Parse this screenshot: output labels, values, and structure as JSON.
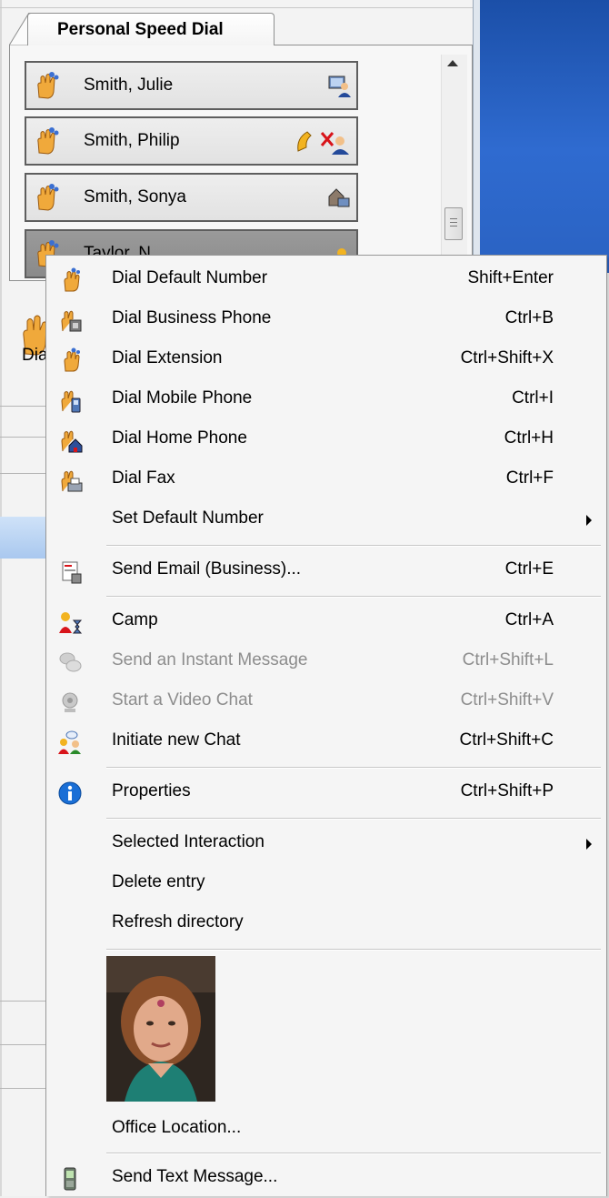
{
  "tab": {
    "label": "Personal Speed Dial"
  },
  "speed_dial": [
    {
      "name": "Smith, Julie",
      "status_icon": "computer-user-icon"
    },
    {
      "name": "Smith, Philip",
      "status_icon": "phone-no-user-icon"
    },
    {
      "name": "Smith, Sonya",
      "status_icon": "home-computer-icon"
    },
    {
      "name": "Taylor, N",
      "status_icon": "user-icon"
    }
  ],
  "background": {
    "dial_label": "Dia"
  },
  "menu": {
    "items": [
      {
        "label": "Dial Default Number",
        "shortcut": "Shift+Enter",
        "icon": "dial-hand-icon"
      },
      {
        "label": "Dial Business Phone",
        "shortcut": "Ctrl+B",
        "icon": "dial-business-icon"
      },
      {
        "label": "Dial Extension",
        "shortcut": "Ctrl+Shift+X",
        "icon": "dial-hand-icon"
      },
      {
        "label": "Dial Mobile Phone",
        "shortcut": "Ctrl+I",
        "icon": "dial-mobile-icon"
      },
      {
        "label": "Dial Home Phone",
        "shortcut": "Ctrl+H",
        "icon": "dial-home-icon"
      },
      {
        "label": "Dial Fax",
        "shortcut": "Ctrl+F",
        "icon": "dial-fax-icon"
      },
      {
        "label": "Set Default Number",
        "shortcut": "",
        "icon": ""
      },
      {
        "label": "Send Email (Business)...",
        "shortcut": "Ctrl+E",
        "icon": "email-icon"
      },
      {
        "label": "Camp",
        "shortcut": "Ctrl+A",
        "icon": "camp-icon"
      },
      {
        "label": "Send an Instant Message",
        "shortcut": "Ctrl+Shift+L",
        "icon": "instant-message-icon",
        "disabled": true
      },
      {
        "label": "Start a Video Chat",
        "shortcut": "Ctrl+Shift+V",
        "icon": "video-chat-icon",
        "disabled": true
      },
      {
        "label": "Initiate new Chat",
        "shortcut": "Ctrl+Shift+C",
        "icon": "chat-icon"
      },
      {
        "label": "Properties",
        "shortcut": "Ctrl+Shift+P",
        "icon": "info-icon"
      },
      {
        "label": "Selected Interaction",
        "shortcut": "",
        "icon": ""
      },
      {
        "label": "Delete entry",
        "shortcut": "",
        "icon": ""
      },
      {
        "label": "Refresh directory",
        "shortcut": "",
        "icon": ""
      },
      {
        "label": "Office Location...",
        "shortcut": "",
        "icon": ""
      },
      {
        "label": "Send Text Message...",
        "shortcut": "",
        "icon": "mobile-phone-icon"
      }
    ]
  },
  "colors": {
    "desktop_blue": "#2f6bd0",
    "info_blue": "#1a6fd6",
    "menu_bg": "#f5f5f5"
  }
}
